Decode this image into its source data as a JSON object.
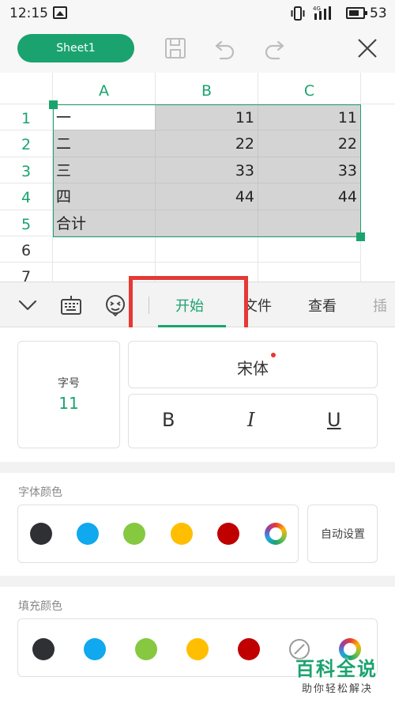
{
  "status_bar": {
    "time": "12:15",
    "network": "4G",
    "battery": "53"
  },
  "toolbar": {
    "sheet_tab": "Sheet1",
    "icons": [
      "save-icon",
      "undo-icon",
      "redo-icon",
      "close-icon"
    ]
  },
  "sheet": {
    "columns": [
      "A",
      "B",
      "C"
    ],
    "row_numbers": [
      "1",
      "2",
      "3",
      "4",
      "5",
      "6",
      "7"
    ],
    "rows": [
      [
        "一",
        "11",
        "11"
      ],
      [
        "二",
        "22",
        "22"
      ],
      [
        "三",
        "33",
        "33"
      ],
      [
        "四",
        "44",
        "44"
      ],
      [
        "合计",
        "",
        ""
      ]
    ]
  },
  "ribbon": {
    "tabs": [
      "开始",
      "文件",
      "查看",
      "插"
    ],
    "active_tab": "开始",
    "icons": [
      "chevron-down-icon",
      "keyboard-icon",
      "emoji-icon"
    ]
  },
  "font_panel": {
    "size_label": "字号",
    "size_value": "11",
    "font_name": "宋体",
    "bold": "B",
    "italic": "I",
    "underline": "U"
  },
  "font_color": {
    "title": "字体颜色",
    "swatches": [
      "#2f3033",
      "#10a8ee",
      "#86c840",
      "#ffbe00",
      "#c00000"
    ],
    "auto_label": "自动设置"
  },
  "fill_color": {
    "title": "填充颜色",
    "swatches": [
      "#2f3033",
      "#10a8ee",
      "#86c840",
      "#ffbe00",
      "#c00000"
    ]
  },
  "colors": {
    "accent": "#1aa36e",
    "highlight": "#e53935",
    "selection": "#d4d4d4"
  },
  "watermark": {
    "title": "百科全说",
    "subtitle": "助你轻松解决"
  }
}
